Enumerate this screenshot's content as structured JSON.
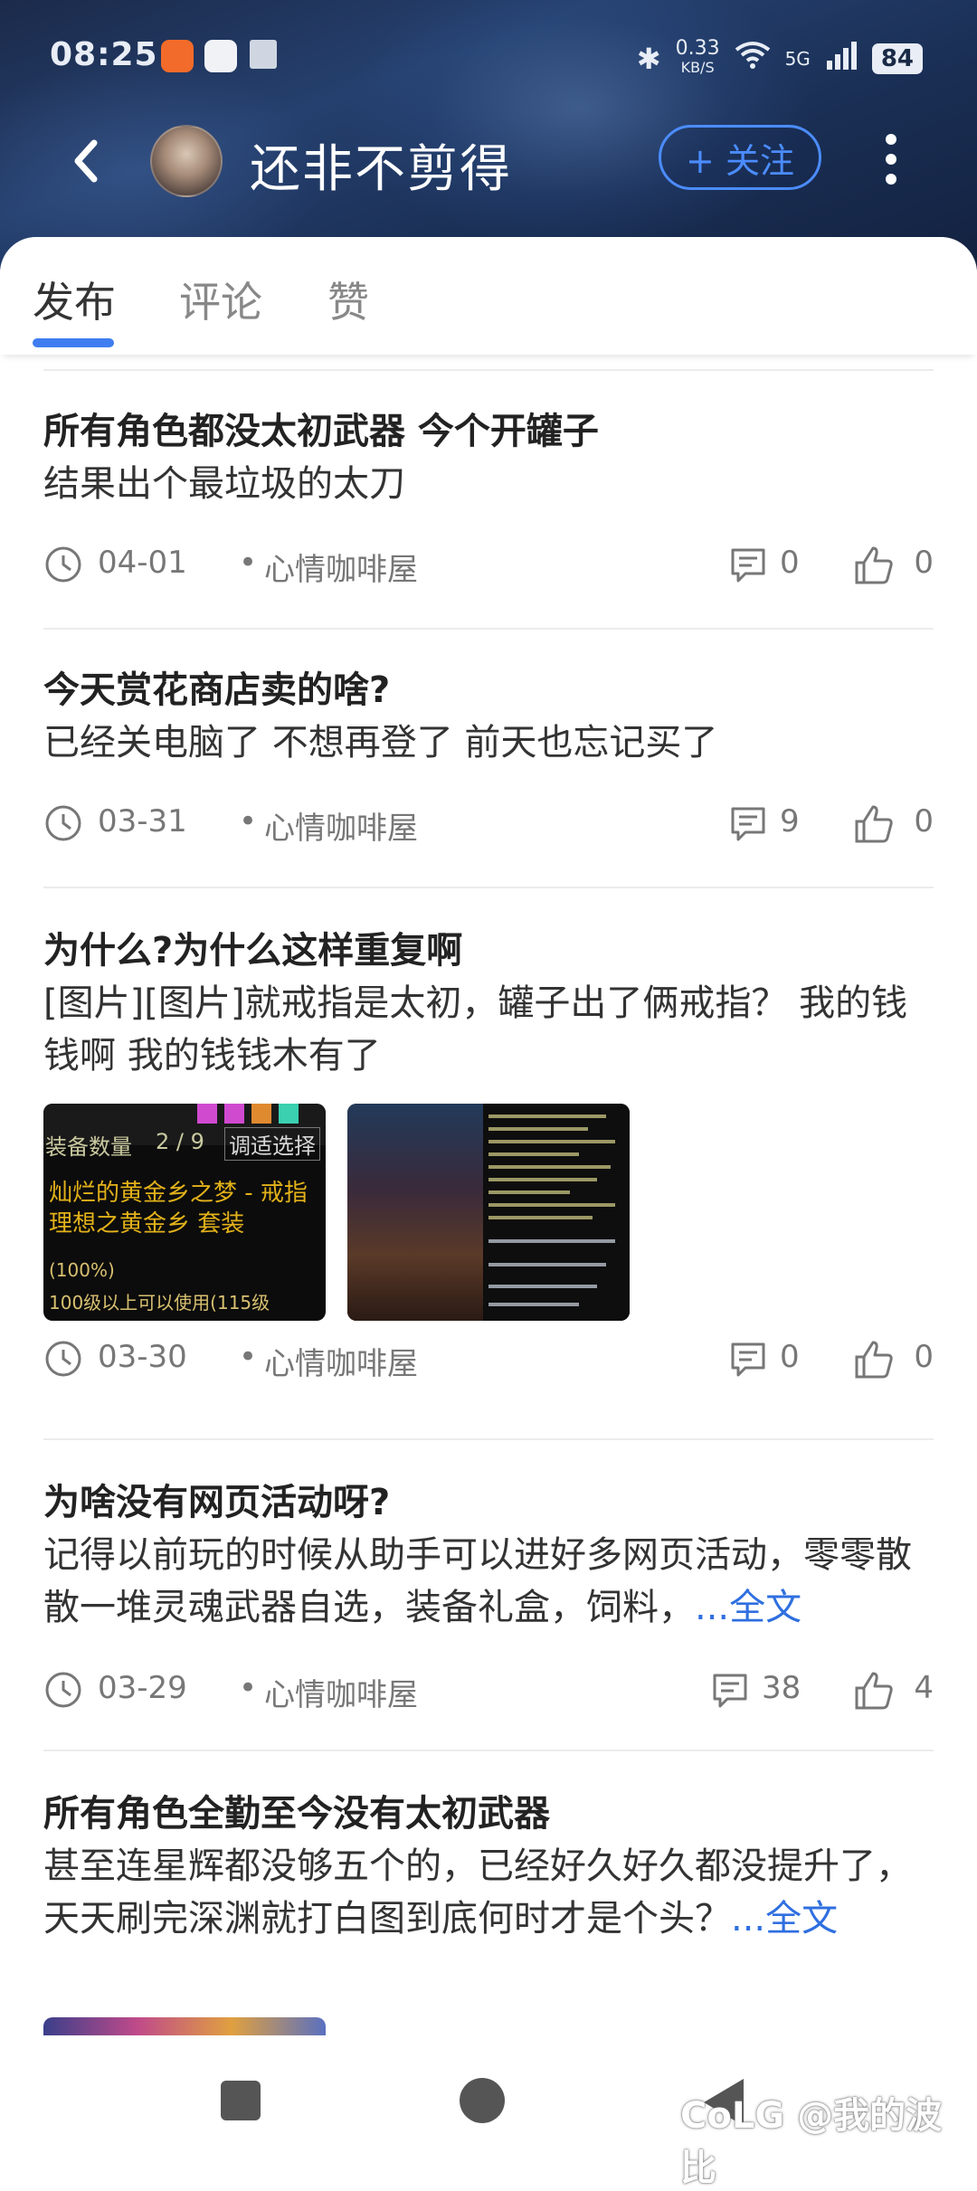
{
  "status_bar": {
    "time": "08:25",
    "speed_value": "0.33",
    "speed_unit": "KB/S",
    "network": "5G",
    "battery": "84",
    "icons": [
      "bluetooth-icon",
      "wifi-icon",
      "signal-icon"
    ]
  },
  "header": {
    "username": "还非不剪得",
    "follow_label": "+ 关注"
  },
  "tabs": [
    "发布",
    "评论",
    "赞"
  ],
  "posts": [
    {
      "title": "所有角色都没太初武器 今个开罐子",
      "body": "结果出个最垃圾的太刀",
      "date": "04-01",
      "dot": "•",
      "category": "心情咖啡屋",
      "comments": "0",
      "likes": "0"
    },
    {
      "title": "今天赏花商店卖的啥?",
      "body": "已经关电脑了 不想再登了 前天也忘记买了",
      "date": "03-31",
      "dot": "•",
      "category": "心情咖啡屋",
      "comments": "9",
      "likes": "0"
    },
    {
      "title": "为什么?为什么这样重复啊",
      "body": "[图片][图片]就戒指是太初，罐子出了俩戒指？ 我的钱钱啊 我的钱钱木有了",
      "date": "03-30",
      "dot": "•",
      "category": "心情咖啡屋",
      "comments": "0",
      "likes": "0",
      "thumb_text": {
        "line1": "灿烂的黄金乡之梦 - 戒指",
        "line2": "理想之黄金乡 套装",
        "line3": "100级以上可以使用(115级",
        "count": "2 / 9",
        "button": "调适选择",
        "label": "装备数量",
        "pct": "(100%)"
      }
    },
    {
      "title": "为啥没有网页活动呀?",
      "body": "记得以前玩的时候从助手可以进好多网页活动，零零散散一堆灵魂武器自选，装备礼盒，饲料，",
      "more": "...全文",
      "date": "03-29",
      "dot": "•",
      "category": "心情咖啡屋",
      "comments": "38",
      "likes": "4"
    },
    {
      "title": "所有角色全勤至今没有太初武器",
      "body": "甚至连星辉都没够五个的，已经好久好久都没提升了，天天刷完深渊就打白图到底何时才是个头？",
      "more": "...全文"
    }
  ],
  "watermark": "CoLG @我的波比",
  "colors": {
    "accent": "#3f7ef0",
    "follow": "#4b8cff",
    "link": "#2f6fe0"
  }
}
